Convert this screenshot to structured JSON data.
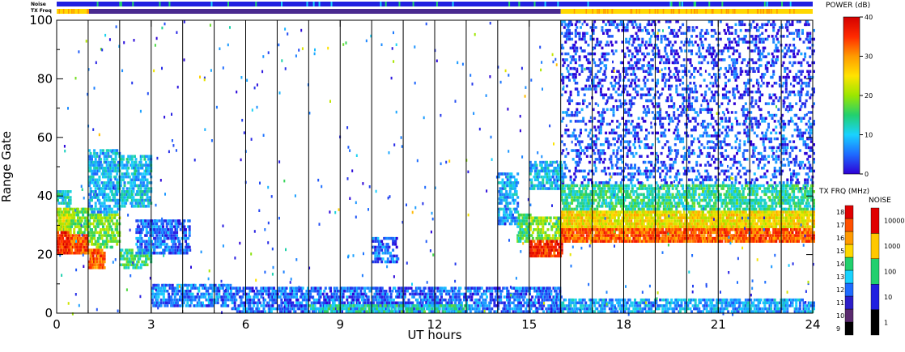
{
  "chart_data": {
    "type": "heatmap",
    "xlabel": "UT hours",
    "ylabel": "Range Gate",
    "xlim": [
      0,
      24
    ],
    "ylim": [
      0,
      100
    ],
    "x_ticks": [
      "0",
      "3",
      "6",
      "9",
      "12",
      "15",
      "18",
      "21",
      "24"
    ],
    "y_ticks": [
      "0",
      "20",
      "40",
      "60",
      "80",
      "100"
    ],
    "scan_boundaries_hours": [
      1,
      2,
      3,
      4,
      5,
      6,
      7,
      8,
      9,
      10,
      11,
      12,
      13,
      14,
      15,
      16,
      17,
      18,
      19,
      20,
      21,
      22,
      23
    ],
    "bands": [
      {
        "h0": 0.0,
        "h1": 0.4,
        "g0": 20,
        "g1": 28,
        "power_db": 36
      },
      {
        "h0": 0.0,
        "h1": 0.4,
        "g0": 28,
        "g1": 36,
        "power_db": 22
      },
      {
        "h0": 0.0,
        "h1": 0.4,
        "g0": 36,
        "g1": 42,
        "power_db": 12
      },
      {
        "h0": 0.4,
        "h1": 1.0,
        "g0": 20,
        "g1": 27,
        "power_db": 33
      },
      {
        "h0": 0.4,
        "h1": 1.0,
        "g0": 27,
        "g1": 36,
        "power_db": 18
      },
      {
        "h0": 1.0,
        "h1": 1.5,
        "g0": 15,
        "g1": 22,
        "power_db": 33
      },
      {
        "h0": 1.0,
        "h1": 2.0,
        "g0": 22,
        "g1": 34,
        "power_db": 18
      },
      {
        "h0": 1.0,
        "h1": 2.0,
        "g0": 34,
        "g1": 56,
        "power_db": 9
      },
      {
        "h0": 2.0,
        "h1": 3.0,
        "g0": 15,
        "g1": 22,
        "power_db": 14
      },
      {
        "h0": 2.0,
        "h1": 3.0,
        "g0": 36,
        "g1": 54,
        "power_db": 10
      },
      {
        "h0": 2.5,
        "h1": 4.2,
        "g0": 20,
        "g1": 32,
        "power_db": 5
      },
      {
        "h0": 3.0,
        "h1": 5.5,
        "g0": 2,
        "g1": 10,
        "power_db": 6
      },
      {
        "h0": 5.5,
        "h1": 16.0,
        "g0": 0,
        "g1": 9,
        "power_db": 5
      },
      {
        "h0": 8.0,
        "h1": 13.0,
        "g0": 0,
        "g1": 3,
        "power_db": 13
      },
      {
        "h0": 10.0,
        "h1": 10.8,
        "g0": 17,
        "g1": 26,
        "power_db": 5
      },
      {
        "h0": 14.0,
        "h1": 14.6,
        "g0": 30,
        "g1": 48,
        "power_db": 8
      },
      {
        "h0": 14.6,
        "h1": 15.0,
        "g0": 24,
        "g1": 34,
        "power_db": 15
      },
      {
        "h0": 15.0,
        "h1": 16.0,
        "g0": 19,
        "g1": 25,
        "power_db": 36
      },
      {
        "h0": 15.0,
        "h1": 16.0,
        "g0": 25,
        "g1": 33,
        "power_db": 19
      },
      {
        "h0": 15.0,
        "h1": 16.0,
        "g0": 42,
        "g1": 52,
        "power_db": 9
      },
      {
        "h0": 16.0,
        "h1": 24.0,
        "g0": 24,
        "g1": 29,
        "power_db": 33
      },
      {
        "h0": 16.0,
        "h1": 24.0,
        "g0": 29,
        "g1": 35,
        "power_db": 25
      },
      {
        "h0": 16.0,
        "h1": 24.0,
        "g0": 35,
        "g1": 44,
        "power_db": 14
      },
      {
        "h0": 16.0,
        "h1": 24.0,
        "g0": 44,
        "g1": 70,
        "power_db": 4
      },
      {
        "h0": 16.0,
        "h1": 24.0,
        "g0": 70,
        "g1": 100,
        "power_db": 3
      },
      {
        "h0": 16.0,
        "h1": 24.0,
        "g0": 0,
        "g1": 5,
        "power_db": 8
      }
    ],
    "noise_strip": {
      "label": "Noise",
      "segments": [
        {
          "h0": 0,
          "h1": 24,
          "level": 10
        }
      ]
    },
    "txfreq_strip": {
      "label": "TX Freq",
      "segments": [
        {
          "h0": 0,
          "h1": 1,
          "mhz": 15
        },
        {
          "h0": 1,
          "h1": 16,
          "mhz": 10
        },
        {
          "h0": 16,
          "h1": 24,
          "mhz": 15
        }
      ]
    },
    "power_colorbar": {
      "title": "POWER (dB)",
      "ticks": [
        "0",
        "10",
        "20",
        "30",
        "40"
      ],
      "range": [
        0,
        40
      ],
      "stops": [
        "#2e00d6",
        "#1e6bff",
        "#19d2ff",
        "#22d06e",
        "#9be600",
        "#ffe300",
        "#ff9a00",
        "#ff2a00",
        "#d40000"
      ]
    },
    "txfrq_colorbar": {
      "title": "TX FRQ (MHz)",
      "ticks": [
        "9",
        "10",
        "11",
        "12",
        "13",
        "14",
        "15",
        "16",
        "17",
        "18"
      ],
      "colors": [
        "#000000",
        "#5a2a6e",
        "#2d1ec8",
        "#1e6bff",
        "#19d2ff",
        "#22d06e",
        "#ffd800",
        "#ff9a00",
        "#ff5000",
        "#e00000"
      ]
    },
    "noise_colorbar": {
      "title": "NOISE",
      "ticks": [
        "1",
        "10",
        "100",
        "1000",
        "10000"
      ],
      "colors": [
        "#000000",
        "#2020e0",
        "#22d06e",
        "#ffc800",
        "#e00000"
      ]
    }
  }
}
